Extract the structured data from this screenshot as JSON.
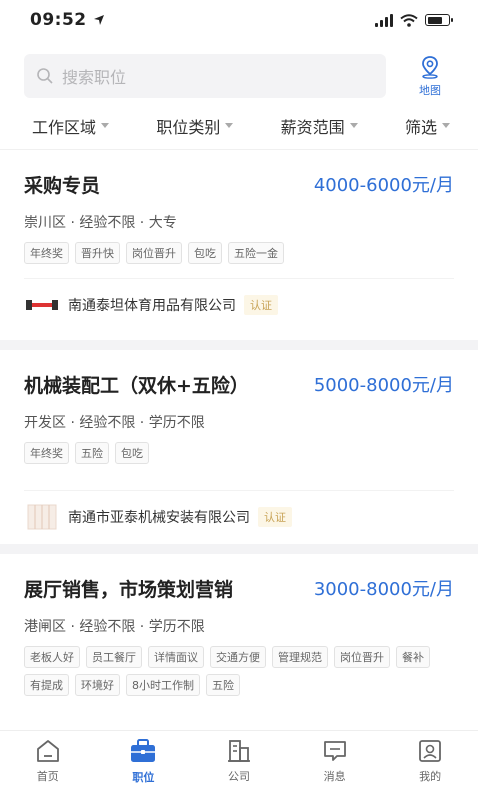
{
  "status": {
    "time": "09:52"
  },
  "search": {
    "placeholder": "搜索职位",
    "map_label": "地图"
  },
  "filters": [
    "工作区域",
    "职位类别",
    "薪资范围",
    "筛选"
  ],
  "jobs": [
    {
      "title": "采购专员",
      "salary": "4000-6000元/月",
      "meta": "崇川区 · 经验不限 · 大专",
      "tags": [
        "年终奖",
        "晋升快",
        "岗位晋升",
        "包吃",
        "五险一金"
      ],
      "company": "南通泰坦体育用品有限公司",
      "badge": "认证"
    },
    {
      "title": "机械装配工（双休+五险）",
      "salary": "5000-8000元/月",
      "meta": "开发区 · 经验不限 · 学历不限",
      "tags": [
        "年终奖",
        "五险",
        "包吃"
      ],
      "company": "南通市亚泰机械安装有限公司",
      "badge": "认证"
    },
    {
      "title": "展厅销售，市场策划营销",
      "salary": "3000-8000元/月",
      "meta": "港闸区 · 经验不限 · 学历不限",
      "tags": [
        "老板人好",
        "员工餐厅",
        "详情面议",
        "交通方便",
        "管理规范",
        "岗位晋升",
        "餐补",
        "有提成",
        "环境好",
        "8小时工作制",
        "五险"
      ]
    }
  ],
  "tabbar": {
    "active": "职位",
    "items": [
      {
        "label": "首页",
        "icon": "home-icon"
      },
      {
        "label": "职位",
        "icon": "briefcase-icon"
      },
      {
        "label": "公司",
        "icon": "building-icon"
      },
      {
        "label": "消息",
        "icon": "message-icon"
      },
      {
        "label": "我的",
        "icon": "profile-icon"
      }
    ]
  },
  "colors": {
    "accent": "#2f6fd6",
    "badge_text": "#c8a356",
    "badge_bg": "#fcf6e6"
  }
}
